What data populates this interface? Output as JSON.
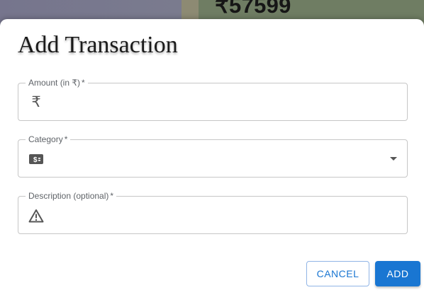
{
  "background": {
    "balance_text": "₹57599"
  },
  "dialog": {
    "title": "Add Transaction",
    "fields": [
      {
        "label": "Amount (in ₹)",
        "required_mark": "*",
        "value": "",
        "icon": "rupee-icon",
        "icon_glyph": "₹"
      },
      {
        "label": "Category",
        "required_mark": "*",
        "value": "",
        "icon": "money-icon",
        "type": "select"
      },
      {
        "label": "Description (optional)",
        "required_mark": "*",
        "value": "",
        "icon": "warning-icon"
      }
    ],
    "buttons": {
      "cancel_label": "CANCEL",
      "add_label": "ADD"
    }
  },
  "colors": {
    "primary": "#1976d2",
    "field_border": "#c6c6c6",
    "label_text": "#5f6368"
  }
}
